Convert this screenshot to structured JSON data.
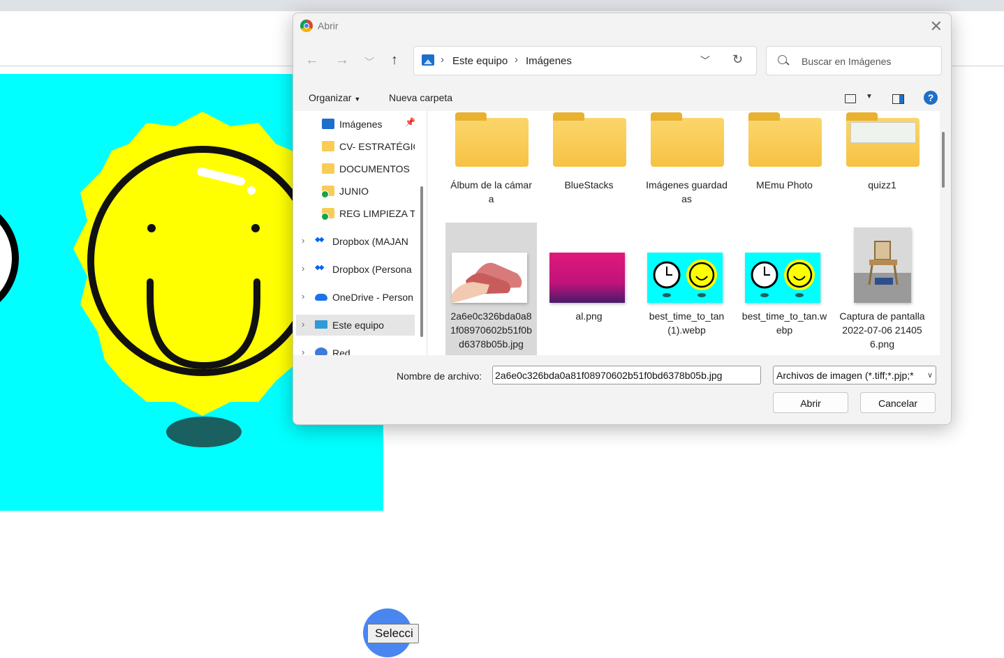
{
  "dialog": {
    "title": "Abrir",
    "path": [
      "Este equipo",
      "Imágenes"
    ],
    "search_placeholder": "Buscar en Imágenes",
    "toolbar": {
      "organize": "Organizar",
      "new_folder": "Nueva carpeta"
    },
    "nav": [
      {
        "label": "Imágenes",
        "icon": "images-icon"
      },
      {
        "label": "CV- ESTRATÉGIC",
        "icon": "folder-icon"
      },
      {
        "label": "DOCUMENTOS",
        "icon": "folder-icon"
      },
      {
        "label": "JUNIO",
        "icon": "folder-synced-icon"
      },
      {
        "label": "REG LIMPIEZA TI",
        "icon": "folder-synced-icon"
      },
      {
        "label": "Dropbox (MAJAN",
        "icon": "dropbox-icon"
      },
      {
        "label": "Dropbox (Persona",
        "icon": "dropbox-icon"
      },
      {
        "label": "OneDrive - Person",
        "icon": "onedrive-icon"
      },
      {
        "label": "Este equipo",
        "icon": "computer-icon"
      },
      {
        "label": "Red",
        "icon": "network-icon"
      }
    ],
    "folders": [
      "Álbum de la cámara",
      "BlueStacks",
      "Imágenes guardadas",
      "MEmu Photo",
      "quizz1"
    ],
    "files": [
      "2a6e0c326bda0a81f08970602b51f0bd6378b05b.jpg",
      "al.png",
      "best_time_to_tan (1).webp",
      "best_time_to_tan.webp",
      "Captura de pantalla 2022-07-06 214056.png"
    ],
    "file_name_label": "Nombre de archivo:",
    "file_name_value": "2a6e0c326bda0a81f08970602b51f0bd6378b05b.jpg",
    "file_type": "Archivos de imagen (*.tiff;*.pjp;*",
    "open_button": "Abrir",
    "cancel_button": "Cancelar"
  },
  "page": {
    "select_button": "Selecci"
  }
}
